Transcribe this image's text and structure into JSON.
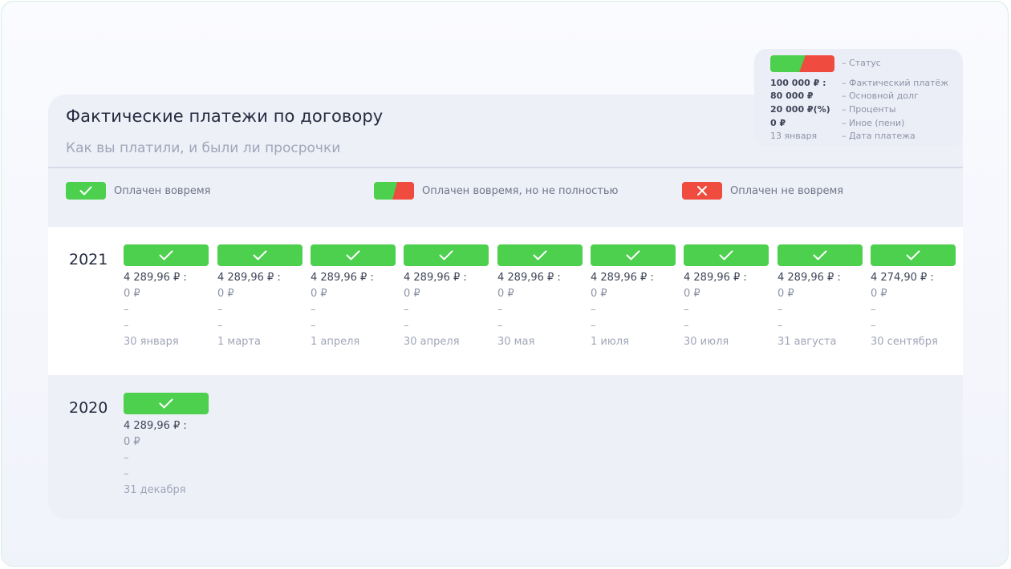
{
  "header": {
    "title": "Фактические платежи по договору",
    "subtitle": "Как вы платили, и были ли просрочки"
  },
  "status_legend": [
    {
      "label": "Оплачен вовремя",
      "type": "on_time"
    },
    {
      "label": "Оплачен вовремя, но не полностью",
      "type": "partial"
    },
    {
      "label": "Оплачен не вовремя",
      "type": "late"
    }
  ],
  "info_legend": {
    "status_desc": "– Статус",
    "rows": [
      {
        "value": "100 000 ₽ :",
        "desc": "– Фактический платёж"
      },
      {
        "value": "80 000 ₽",
        "desc": "– Основной долг"
      },
      {
        "value": "20 000 ₽(%)",
        "desc": "– Проценты"
      },
      {
        "value": "0 ₽",
        "desc": "– Иное (пени)"
      },
      {
        "value": "13 января",
        "desc": "– Дата платежа",
        "muted": true
      }
    ]
  },
  "years": [
    {
      "year": "2021",
      "payments": [
        {
          "status": "on_time",
          "amount": "4 289,96 ₽ :",
          "principal": "0 ₽",
          "interest": "–",
          "other": "–",
          "date": "30 января"
        },
        {
          "status": "on_time",
          "amount": "4 289,96 ₽ :",
          "principal": "0 ₽",
          "interest": "–",
          "other": "–",
          "date": "1 марта"
        },
        {
          "status": "on_time",
          "amount": "4 289,96 ₽ :",
          "principal": "0 ₽",
          "interest": "–",
          "other": "–",
          "date": "1 апреля"
        },
        {
          "status": "on_time",
          "amount": "4 289,96 ₽ :",
          "principal": "0 ₽",
          "interest": "–",
          "other": "–",
          "date": "30 апреля"
        },
        {
          "status": "on_time",
          "amount": "4 289,96 ₽ :",
          "principal": "0 ₽",
          "interest": "–",
          "other": "–",
          "date": "30 мая"
        },
        {
          "status": "on_time",
          "amount": "4 289,96 ₽ :",
          "principal": "0 ₽",
          "interest": "–",
          "other": "–",
          "date": "1 июля"
        },
        {
          "status": "on_time",
          "amount": "4 289,96 ₽ :",
          "principal": "0 ₽",
          "interest": "–",
          "other": "–",
          "date": "30 июля"
        },
        {
          "status": "on_time",
          "amount": "4 289,96 ₽ :",
          "principal": "0 ₽",
          "interest": "–",
          "other": "–",
          "date": "31 августа"
        },
        {
          "status": "on_time",
          "amount": "4 274,90 ₽ :",
          "principal": "0 ₽",
          "interest": "–",
          "other": "–",
          "date": "30 сентября"
        }
      ]
    },
    {
      "year": "2020",
      "payments": [
        {
          "status": "on_time",
          "amount": "4 289,96 ₽ :",
          "principal": "0 ₽",
          "interest": "–",
          "other": "–",
          "date": "31 декабря"
        }
      ]
    }
  ],
  "colors": {
    "on_time": "#4cd04e",
    "late": "#ef4b3f",
    "text_dark": "#262c3f",
    "text_muted": "#a0a6b8"
  },
  "icons": {
    "on_time": "check-icon",
    "late": "cross-icon"
  }
}
